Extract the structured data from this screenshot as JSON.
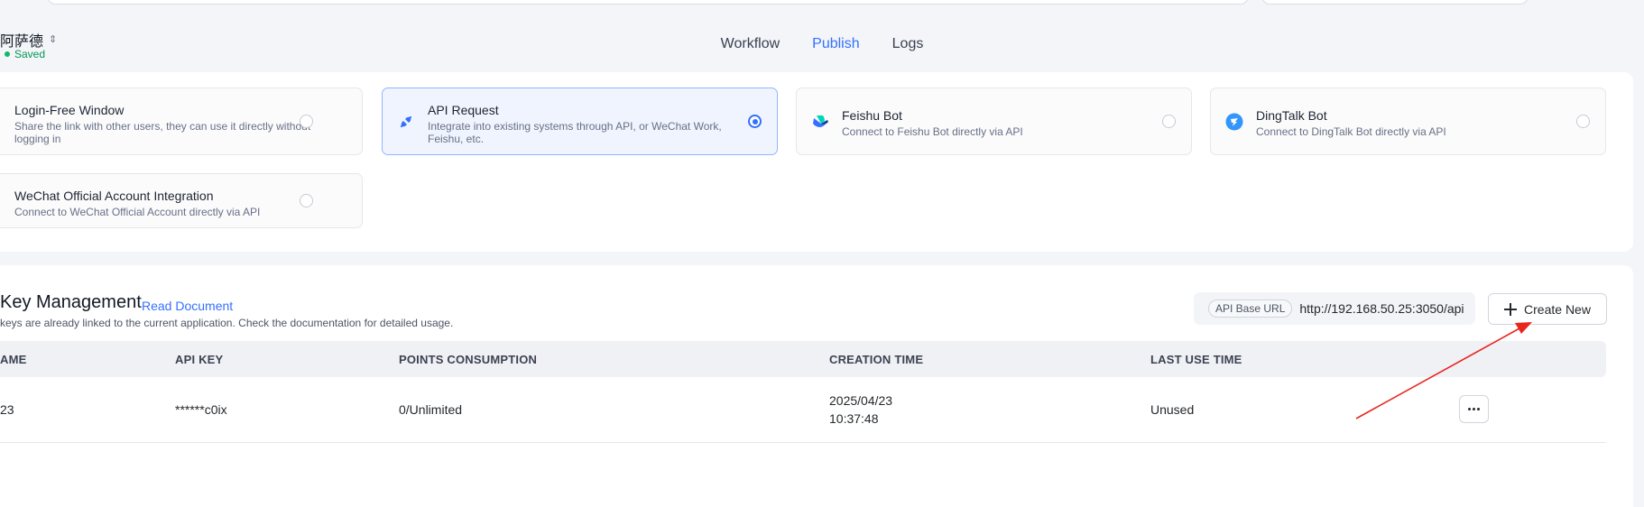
{
  "header": {
    "app_name": "阿萨德",
    "status": "Saved",
    "tabs": [
      {
        "label": "Workflow",
        "active": false
      },
      {
        "label": "Publish",
        "active": true
      },
      {
        "label": "Logs",
        "active": false
      }
    ]
  },
  "channels": [
    {
      "title": "Login-Free Window",
      "desc": "Share the link with other users, they can use it directly without logging in",
      "selected": false,
      "icon": "none"
    },
    {
      "title": "API Request",
      "desc": "Integrate into existing systems through API, or WeChat Work, Feishu, etc.",
      "selected": true,
      "icon": "api-plug-icon"
    },
    {
      "title": "Feishu Bot",
      "desc": "Connect to Feishu Bot directly via API",
      "selected": false,
      "icon": "feishu-icon"
    },
    {
      "title": "DingTalk Bot",
      "desc": "Connect to DingTalk Bot directly via API",
      "selected": false,
      "icon": "dingtalk-icon"
    },
    {
      "title": "WeChat Official Account Integration",
      "desc": "Connect to WeChat Official Account directly via API",
      "selected": false,
      "icon": "none"
    }
  ],
  "key_management": {
    "title": "Key Management",
    "read_doc": "Read Document",
    "desc": "keys are already linked to the current application. Check the documentation for detailed usage.",
    "api_base_label": "API Base URL",
    "api_base_url": "http://192.168.50.25:3050/api",
    "create_label": "Create New",
    "columns": [
      "AME",
      "API KEY",
      "POINTS CONSUMPTION",
      "CREATION TIME",
      "LAST USE TIME"
    ],
    "rows": [
      {
        "name": "23",
        "api_key": "******c0ix",
        "points": "0/Unlimited",
        "creation_date": "2025/04/23",
        "creation_time": "10:37:48",
        "last_use": "Unused"
      }
    ]
  },
  "colors": {
    "accent": "#3370ff",
    "saved_green": "#12b76a",
    "annotation_red": "#e8261c"
  }
}
